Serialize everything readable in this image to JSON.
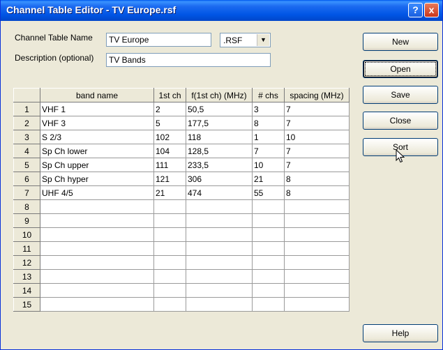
{
  "window": {
    "title": "Channel Table Editor - TV Europe.rsf"
  },
  "titlebar_buttons": {
    "help": "?",
    "close": "x"
  },
  "form": {
    "name_label": "Channel Table Name",
    "name_value": "TV Europe",
    "ext_value": ".RSF",
    "desc_label": "Description (optional)",
    "desc_value": "TV Bands"
  },
  "buttons": {
    "new": "New",
    "open": "Open",
    "save": "Save",
    "close": "Close",
    "sort": "Sort",
    "help": "Help"
  },
  "table": {
    "headers": [
      "band name",
      "1st ch",
      "f(1st ch) (MHz)",
      "# chs",
      "spacing (MHz)"
    ],
    "rows": [
      [
        "1",
        "VHF 1",
        "2",
        "50,5",
        "3",
        "7"
      ],
      [
        "2",
        "VHF 3",
        "5",
        "177,5",
        "8",
        "7"
      ],
      [
        "3",
        "S 2/3",
        "102",
        "118",
        "1",
        "10"
      ],
      [
        "4",
        "Sp Ch lower",
        "104",
        "128,5",
        "7",
        "7"
      ],
      [
        "5",
        "Sp Ch upper",
        "111",
        "233,5",
        "10",
        "7"
      ],
      [
        "6",
        "Sp Ch hyper",
        "121",
        "306",
        "21",
        "8"
      ],
      [
        "7",
        "UHF 4/5",
        "21",
        "474",
        "55",
        "8"
      ],
      [
        "8",
        "",
        "",
        "",
        "",
        ""
      ],
      [
        "9",
        "",
        "",
        "",
        "",
        ""
      ],
      [
        "10",
        "",
        "",
        "",
        "",
        ""
      ],
      [
        "11",
        "",
        "",
        "",
        "",
        ""
      ],
      [
        "12",
        "",
        "",
        "",
        "",
        ""
      ],
      [
        "13",
        "",
        "",
        "",
        "",
        ""
      ],
      [
        "14",
        "",
        "",
        "",
        "",
        ""
      ],
      [
        "15",
        "",
        "",
        "",
        "",
        ""
      ]
    ]
  }
}
